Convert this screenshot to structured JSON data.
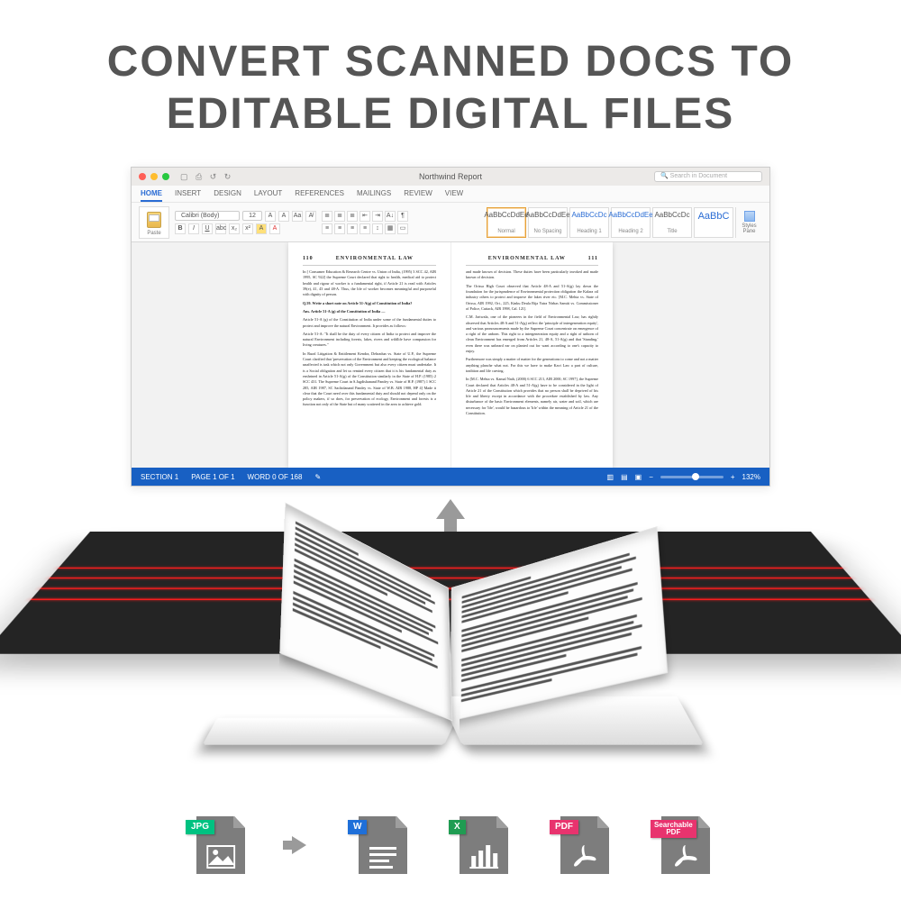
{
  "headline_line1": "CONVERT SCANNED DOCS TO",
  "headline_line2": "EDITABLE DIGITAL FILES",
  "word": {
    "title": "Northwind Report",
    "search_placeholder": "Search in Document",
    "tabs": [
      "HOME",
      "INSERT",
      "DESIGN",
      "LAYOUT",
      "REFERENCES",
      "MAILINGS",
      "REVIEW",
      "VIEW"
    ],
    "active_tab": "HOME",
    "paste_label": "Paste",
    "font_name": "Calibri (Body)",
    "font_size": "12",
    "styles": [
      {
        "preview": "AaBbCcDdEe",
        "name": "Normal"
      },
      {
        "preview": "AaBbCcDdEe",
        "name": "No Spacing"
      },
      {
        "preview": "AaBbCcDc",
        "name": "Heading 1"
      },
      {
        "preview": "AaBbCcDdEe",
        "name": "Heading 2"
      },
      {
        "preview": "AaBbCcDc",
        "name": "Title"
      },
      {
        "preview": "AaBbC",
        "name": ""
      }
    ],
    "styles_pane": "Styles\nPane",
    "doc_header": "ENVIRONMENTAL LAW",
    "page_left_num": "110",
    "page_right_num": "111",
    "para_l1": "In [ Consumer Education & Research Centre vs. Union of India, (1995) 3 SCC 42, AIR 1995, SC 922] the Supreme Court declared that right to health, medical aid to protect health and rigour of worker is a fundamental right, if Article 21 is read with Articles 39(e), 41, 43 and 48-A. Thus, the life of worker becomes meaningful and purposeful with dignity of person.",
    "para_l2": "Q.59. Write a short note on Article 51-A(g) of Constitution of India?",
    "para_l3": "Ans. Article 51-A (g) of the Constitution of India —",
    "para_l4": "Article 51-A (g) of the Constitution of India under some of the fundamental duties to protect and improve the natural Environment. It provides as follows:",
    "para_l5": "Article 51-A: \"It shall be the duty of every citizen of India to protect and improve the natural Environment including forests, lakes, rivers and wildlife have compassion for living creatures.\"",
    "para_l6": "In Rural Litigation & Entitlement Kendra, Dehradun vs. State of U.P., the Supreme Court clarified that 'preservation of the Environment and keeping the ecological balance unaffected is task which not only Government but also every citizen must undertake. It is a Social obligation and let us remind every citizen that it is his fundamental duty as enshrined in Article 51-A(g) of the Constitution similarly in the State of H.P. (1985) 2 SCC 431. The Supreme Court in S.Jagdishanand Pandey vs. State of H.P. (1987) 1 SCC 285, AIR 1987, SC Sachidanand Pandey vs. State of W.B. AIR 1988, HP 4] Made it clear that the Court need over this fundamental duty and should not depend only on the policy makers, if so does, for preservation of ecology, Environment and forests is a function not only of the State but of many scattered in the area to achieve gold.",
    "para_r1": "and made known of decision. These duties have been particularly invoked and made known of decision.",
    "para_r2": "The Orissa High Court observed that Article 48-A and 51-A(g) lay down the foundation for the jurisprudence of Environmental protection obligation the Kalara oil industry others to protect and improve the lakes river etc. [M.C. Mehta vs. State of Orissa, AIR 1992, Ori., 225, Kinku Deula Bija Yatra Nirbas Samiti vs. Commissioner of Police, Cuttack, AIR 1998, Cal. 121].",
    "para_r3": "C.M. Jariwala, one of the pioneers in the field of Environmental Law, has rightly observed that Articles 48-A and 51-A(g) reflect the 'principle of intergeneration equity', and various pronouncements made by the Supreme Court concentrate on emergence of a right of the unborn. This right to a intergeneration equity and a right of unborn of clean Environment has emerged from Articles 21, 48-A, 51-A(g) and that 'Standing.' even there was unheard ear on planted out for want according to one's capacity to enjoy.",
    "para_r4": "Furthermore was simply a matter of matter for the generations to come and not a matter anything planche what not. For this we have to make Kavi Law a part of culture, tradition and life carving.",
    "para_r5": "In [M.C. Mehta vs. Kamal Nath, (2000) 6 SCC 213, AIR 2000, SC 1997], the Supreme Court declared that Articles 48-A and 51-A(g) have to be considered in the light of Article 21 of the Constitution which provides that no person shall be deprived of his life and liberty except in accordance with the procedure established by law. Any disturbance of the basic Environment elements, namely air, water and soil, which are necessary for 'life', would be hazardous to 'life' within the meaning of Article 21 of the Constitution.",
    "status_section": "SECTION 1",
    "status_page": "PAGE 1 OF 1",
    "status_words": "WORD 0 OF 168",
    "status_zoom": "132%"
  },
  "formats": {
    "jpg": "JPG",
    "w": "W",
    "x": "X",
    "pdf": "PDF",
    "spdf": "Searchable\nPDF"
  }
}
